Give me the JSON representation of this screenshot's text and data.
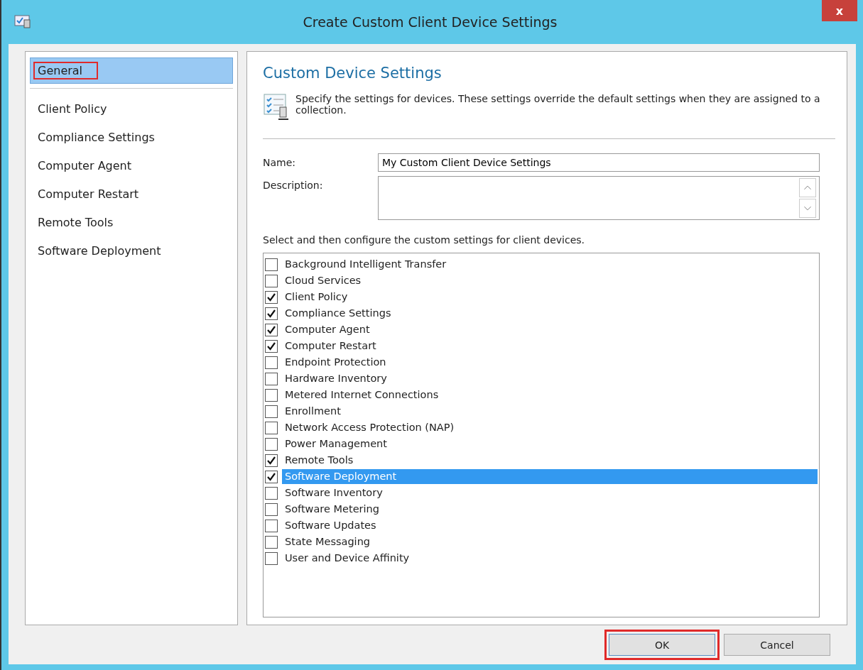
{
  "window": {
    "title": "Create Custom Client Device Settings",
    "close": "x"
  },
  "nav": [
    {
      "label": "General",
      "selected": true,
      "highlighted": true
    },
    {
      "label": "Client Policy",
      "selected": false,
      "highlighted": false
    },
    {
      "label": "Compliance Settings",
      "selected": false,
      "highlighted": false
    },
    {
      "label": "Computer Agent",
      "selected": false,
      "highlighted": false
    },
    {
      "label": "Computer Restart",
      "selected": false,
      "highlighted": false
    },
    {
      "label": "Remote Tools",
      "selected": false,
      "highlighted": false
    },
    {
      "label": "Software Deployment",
      "selected": false,
      "highlighted": false
    }
  ],
  "page": {
    "heading": "Custom Device Settings",
    "intro": "Specify the settings for devices. These settings override the default settings when they are assigned to a collection.",
    "name_label": "Name:",
    "name_value": "My Custom Client Device Settings",
    "description_label": "Description:",
    "list_caption": "Select and then configure the custom settings for client devices.",
    "settings": [
      {
        "label": "Background Intelligent Transfer",
        "checked": false,
        "selected": false
      },
      {
        "label": "Cloud Services",
        "checked": false,
        "selected": false
      },
      {
        "label": "Client Policy",
        "checked": true,
        "selected": false
      },
      {
        "label": "Compliance Settings",
        "checked": true,
        "selected": false
      },
      {
        "label": "Computer Agent",
        "checked": true,
        "selected": false
      },
      {
        "label": "Computer Restart",
        "checked": true,
        "selected": false
      },
      {
        "label": "Endpoint Protection",
        "checked": false,
        "selected": false
      },
      {
        "label": "Hardware Inventory",
        "checked": false,
        "selected": false
      },
      {
        "label": "Metered Internet Connections",
        "checked": false,
        "selected": false
      },
      {
        "label": "Enrollment",
        "checked": false,
        "selected": false
      },
      {
        "label": "Network Access Protection (NAP)",
        "checked": false,
        "selected": false
      },
      {
        "label": "Power Management",
        "checked": false,
        "selected": false
      },
      {
        "label": "Remote Tools",
        "checked": true,
        "selected": false
      },
      {
        "label": "Software Deployment",
        "checked": true,
        "selected": true
      },
      {
        "label": "Software Inventory",
        "checked": false,
        "selected": false
      },
      {
        "label": "Software Metering",
        "checked": false,
        "selected": false
      },
      {
        "label": "Software Updates",
        "checked": false,
        "selected": false
      },
      {
        "label": "State Messaging",
        "checked": false,
        "selected": false
      },
      {
        "label": "User and Device Affinity",
        "checked": false,
        "selected": false
      }
    ]
  },
  "buttons": [
    {
      "label": "OK",
      "highlighted": true
    },
    {
      "label": "Cancel",
      "highlighted": false
    }
  ]
}
